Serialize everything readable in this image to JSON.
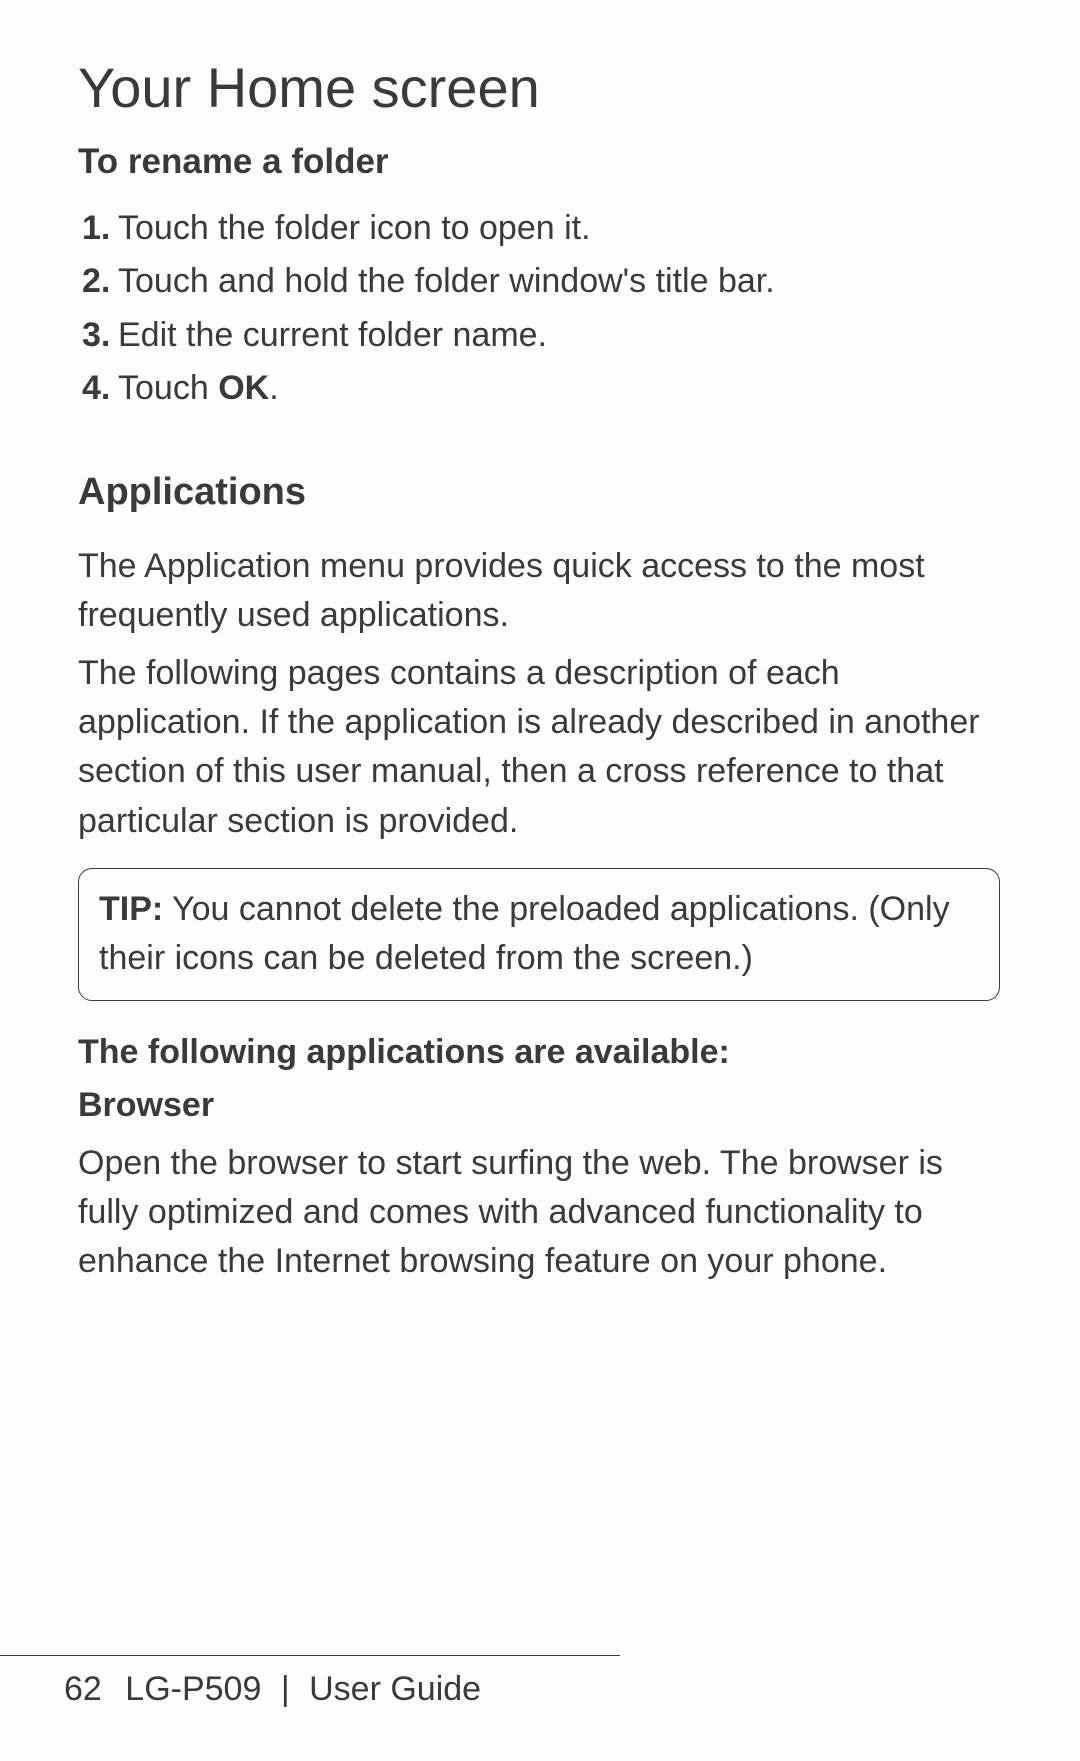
{
  "title": "Your Home screen",
  "rename_section": {
    "heading": "To rename a folder",
    "steps": [
      "Touch the folder icon to open it.",
      "Touch and hold the folder window's title bar.",
      "Edit the current folder name.",
      "Touch "
    ],
    "step4_bold": "OK",
    "step4_after": "."
  },
  "applications": {
    "heading": "Applications",
    "para1": "The Application menu provides quick access to the most frequently used applications.",
    "para2": "The following pages contains a description of each application. If the application is already described in another section of this user manual, then a cross reference to that particular section is provided.",
    "tip_label": "TIP:",
    "tip_text": " You cannot delete the preloaded applications. (Only their icons can be deleted from the screen.)",
    "available_heading": "The following applications are available:",
    "browser_name": "Browser",
    "browser_desc": "Open the browser to start surfing the web. The browser is fully optimized and comes with advanced functionality to enhance the Internet browsing feature on your phone."
  },
  "footer": {
    "page_number": "62",
    "device": "LG-P509",
    "separator": "|",
    "label": "User Guide"
  }
}
